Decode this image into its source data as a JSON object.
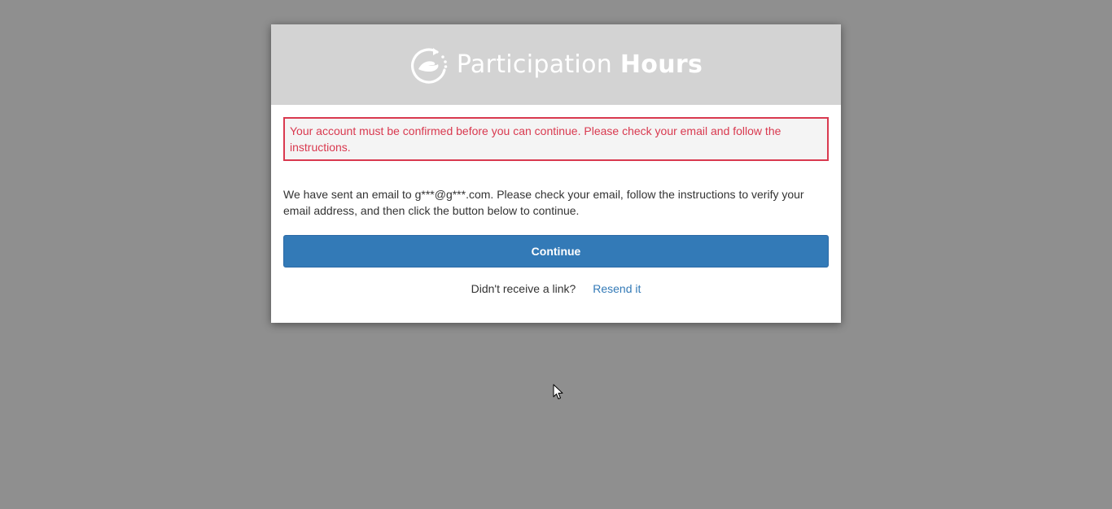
{
  "header": {
    "brand_light": "Participation ",
    "brand_bold": "Hours",
    "logo_icon": "hand-cycle-icon"
  },
  "alert": {
    "text": "Your account must be confirmed before you can continue. Please check your email and follow the instructions."
  },
  "message": {
    "text": "We have sent an email to g***@g***.com. Please check your email, follow the instructions to verify your email address, and then click the button below to continue."
  },
  "continue_button": {
    "label": "Continue"
  },
  "resend": {
    "question": "Didn't receive a link?",
    "link_label": "Resend it"
  },
  "colors": {
    "page_background": "#8f8f8f",
    "header_background": "#d3d3d3",
    "alert_red": "#d9394f",
    "primary_blue": "#337ab7"
  }
}
